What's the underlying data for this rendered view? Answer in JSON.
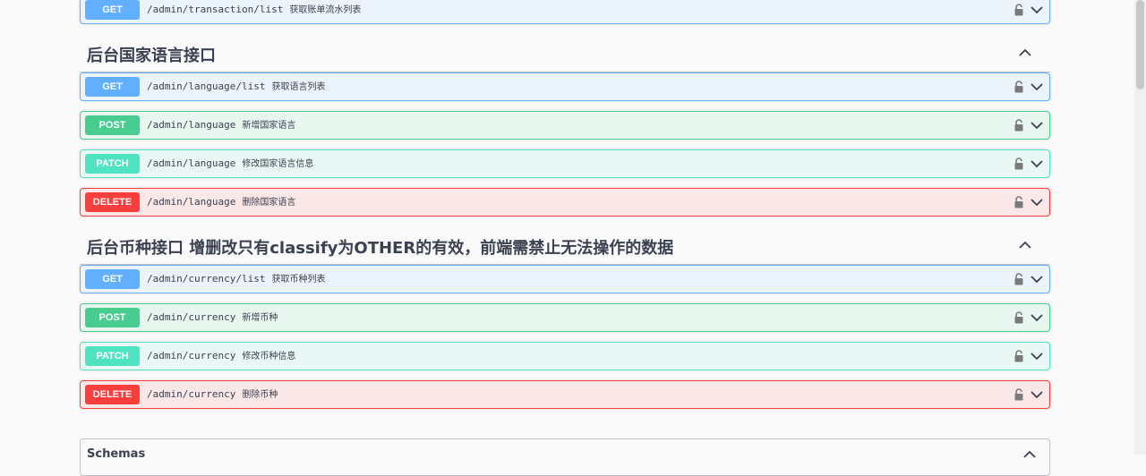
{
  "sections": [
    {
      "title": "",
      "operations": [
        {
          "method": "GET",
          "path": "/admin/transaction/list",
          "summary": "获取账单流水列表"
        }
      ]
    },
    {
      "title": "后台国家语言接口",
      "operations": [
        {
          "method": "GET",
          "path": "/admin/language/list",
          "summary": "获取语言列表"
        },
        {
          "method": "POST",
          "path": "/admin/language",
          "summary": "新增国家语言"
        },
        {
          "method": "PATCH",
          "path": "/admin/language",
          "summary": "修改国家语言信息"
        },
        {
          "method": "DELETE",
          "path": "/admin/language",
          "summary": "删除国家语言"
        }
      ]
    },
    {
      "title": "后台币种接口 增删改只有classify为OTHER的有效，前端需禁止无法操作的数据",
      "operations": [
        {
          "method": "GET",
          "path": "/admin/currency/list",
          "summary": "获取币种列表"
        },
        {
          "method": "POST",
          "path": "/admin/currency",
          "summary": "新增币种"
        },
        {
          "method": "PATCH",
          "path": "/admin/currency",
          "summary": "修改币种信息"
        },
        {
          "method": "DELETE",
          "path": "/admin/currency",
          "summary": "删除币种"
        }
      ]
    }
  ],
  "schemas": {
    "title": "Schemas"
  },
  "icons": {
    "lock": "lock-icon",
    "expand": "chevron-down-icon",
    "collapse": "chevron-up-icon"
  },
  "colors": {
    "get": "#61affe",
    "post": "#49cc90",
    "patch": "#50e3c2",
    "delete": "#f93e3e",
    "text": "#3b4151"
  }
}
